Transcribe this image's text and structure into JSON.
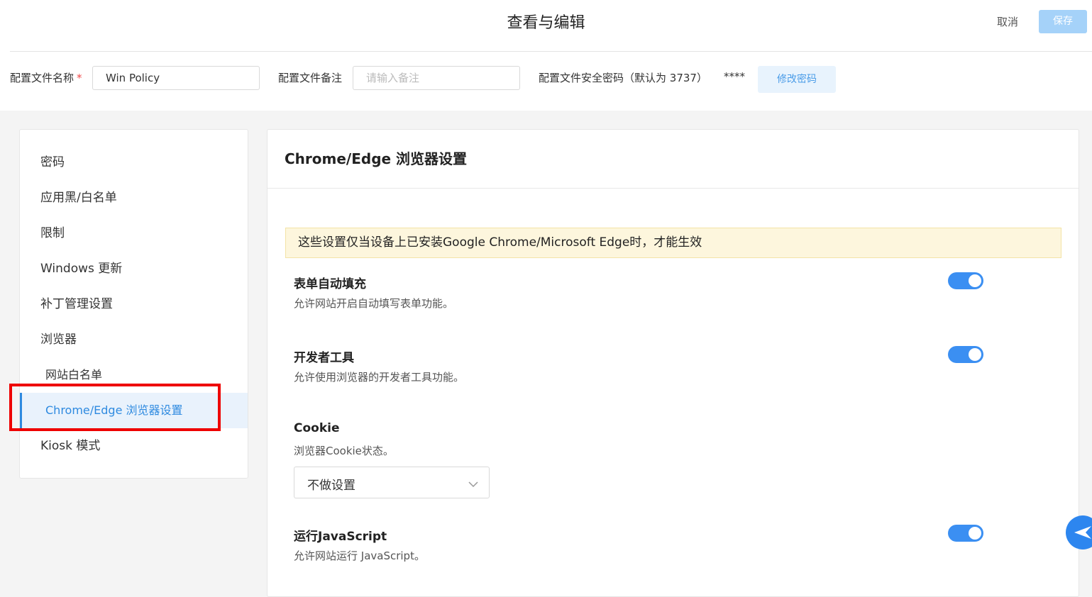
{
  "header": {
    "title": "查看与编辑",
    "cancel_label": "取消",
    "save_label": "保存"
  },
  "profile": {
    "name_label": "配置文件名称",
    "required_mark": "*",
    "name_value": "Win Policy",
    "note_label": "配置文件备注",
    "note_placeholder": "请输入备注",
    "password_label": "配置文件安全密码（默认为 3737）",
    "password_mask": "****",
    "change_password_label": "修改密码"
  },
  "sidebar": {
    "items": [
      {
        "label": "密码"
      },
      {
        "label": "应用黑/白名单"
      },
      {
        "label": "限制"
      },
      {
        "label": "Windows 更新"
      },
      {
        "label": "补丁管理设置"
      },
      {
        "label": "浏览器"
      },
      {
        "label": "网站白名单"
      },
      {
        "label": "Chrome/Edge 浏览器设置"
      },
      {
        "label": "Kiosk 模式"
      }
    ],
    "active_item": "Chrome/Edge 浏览器设置"
  },
  "main": {
    "title": "Chrome/Edge 浏览器设置",
    "notice": "这些设置仅当设备上已安装Google Chrome/Microsoft Edge时，才能生效",
    "settings": [
      {
        "title": "表单自动填充",
        "desc": "允许网站开启自动填写表单功能。",
        "enabled": true
      },
      {
        "title": "开发者工具",
        "desc": "允许使用浏览器的开发者工具功能。",
        "enabled": true
      },
      {
        "title": "Cookie",
        "desc": "浏览器Cookie状态。",
        "select_value": "不做设置"
      },
      {
        "title": "运行JavaScript",
        "desc": "允许网站运行 JavaScript。",
        "enabled": true
      }
    ]
  },
  "colors": {
    "accent": "#2e8ae0",
    "toggle_on": "#3b8ff2",
    "save_disabled": "#a5d2f9",
    "highlight": "#ee0000",
    "notice_bg": "#fdf6dd"
  }
}
